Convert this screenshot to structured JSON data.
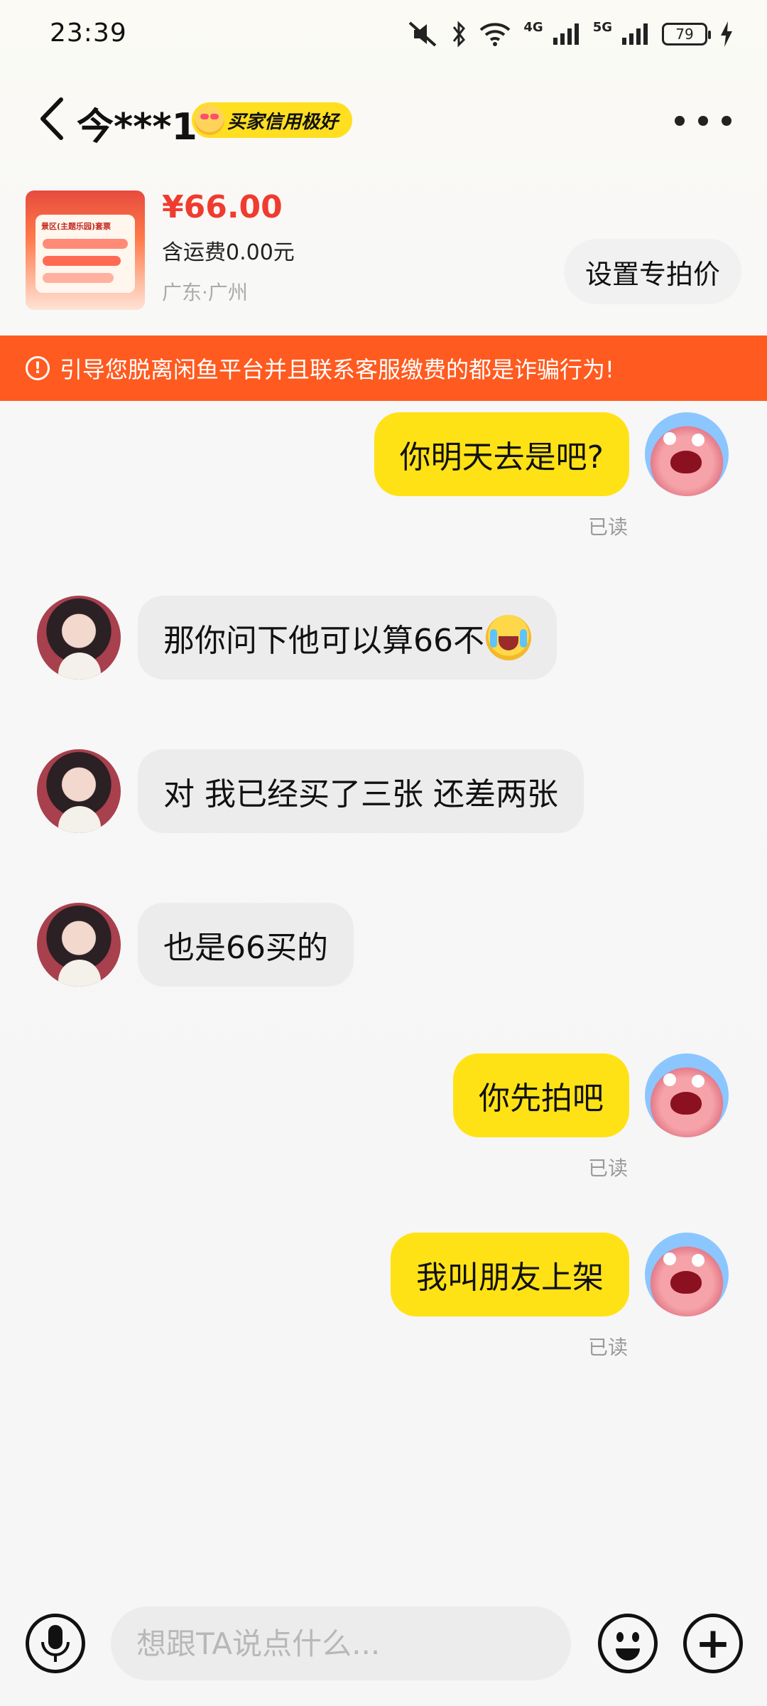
{
  "status_bar": {
    "time": "23:39",
    "battery_level": "79",
    "network_1": "4G",
    "network_2": "5G"
  },
  "header": {
    "contact_name": "今***1",
    "credit_badge": "买家信用极好"
  },
  "product": {
    "price": "¥66.00",
    "shipping": "含运费0.00元",
    "location": "广东·广州",
    "special_price_button": "设置专拍价",
    "thumbnail_title": "景区(主题乐园)套票"
  },
  "warning": {
    "text": "引导您脱离闲鱼平台并且联系客服缴费的都是诈骗行为!"
  },
  "messages": [
    {
      "sender": "me",
      "text": "你明天去是吧?",
      "read_label": "已读"
    },
    {
      "sender": "other",
      "text": "那你问下他可以算66不",
      "emoji": "crying-laughing"
    },
    {
      "sender": "other",
      "text": "对 我已经买了三张 还差两张"
    },
    {
      "sender": "other",
      "text": "也是66买的"
    },
    {
      "sender": "me",
      "text": "你先拍吧",
      "read_label": "已读"
    },
    {
      "sender": "me",
      "text": "我叫朋友上架",
      "read_label": "已读"
    }
  ],
  "input": {
    "placeholder": "想跟TA说点什么..."
  },
  "icons": {
    "back": "chevron-left-icon",
    "more": "more-dots-icon",
    "mic": "microphone-icon",
    "emoji": "smiley-icon",
    "plus": "plus-icon",
    "warning": "warning-circle-icon"
  },
  "colors": {
    "accent_yellow": "#ffe216",
    "warning_orange": "#ff5a1f",
    "price_red": "#f03b2f"
  }
}
